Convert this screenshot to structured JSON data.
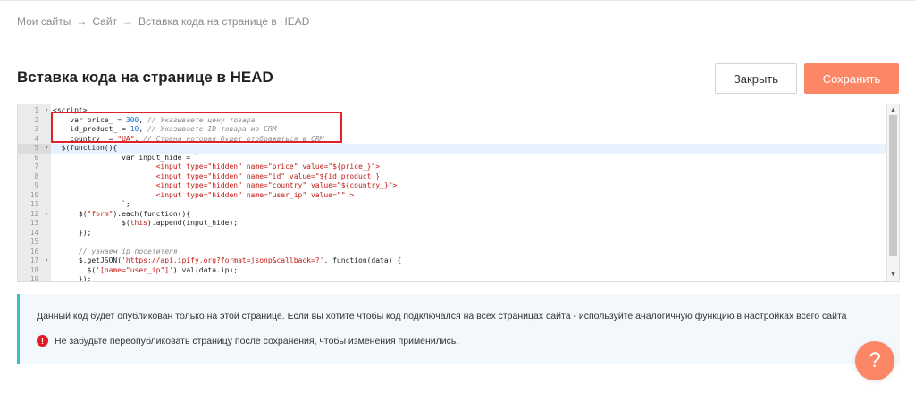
{
  "breadcrumb": {
    "items": [
      "Мои сайты",
      "Сайт",
      "Вставка кода на странице в HEAD"
    ],
    "separator": "→"
  },
  "header": {
    "title": "Вставка кода на странице в HEAD",
    "close_label": "Закрыть",
    "save_label": "Сохранить"
  },
  "editor": {
    "line_numbers": [
      "1",
      "2",
      "3",
      "4",
      "5",
      "6",
      "7",
      "8",
      "9",
      "10",
      "11",
      "12",
      "13",
      "14",
      "15",
      "16",
      "17",
      "18",
      "19"
    ],
    "fold_lines": [
      "1",
      "5",
      "12",
      "17"
    ],
    "active_line": "5",
    "lines": [
      [
        [
          "<script>",
          "plain"
        ]
      ],
      [
        [
          "    var price_ = ",
          "plain"
        ],
        [
          "300",
          "num"
        ],
        [
          ", ",
          "plain"
        ],
        [
          "// Указываете цену товара",
          "com"
        ]
      ],
      [
        [
          "    id_product_ = ",
          "plain"
        ],
        [
          "10",
          "num"
        ],
        [
          ", ",
          "plain"
        ],
        [
          "// Указываете ID товара из CRM",
          "com"
        ]
      ],
      [
        [
          "    country_ = ",
          "plain"
        ],
        [
          "\"UA\"",
          "str"
        ],
        [
          "; ",
          "plain"
        ],
        [
          "// Страна которая будет отображаться в CRM",
          "com"
        ]
      ],
      [
        [
          "  $(function(){",
          "plain"
        ]
      ],
      [
        [
          "                var input_hide = `",
          "plain"
        ]
      ],
      [
        [
          "                        ",
          "plain"
        ],
        [
          "<input type=\"hidden\" name=\"price\" value=\"${price_}\">",
          "tag"
        ]
      ],
      [
        [
          "                        ",
          "plain"
        ],
        [
          "<input type=\"hidden\" name=\"id\" value=\"${id_product_}",
          "tag"
        ]
      ],
      [
        [
          "                        ",
          "plain"
        ],
        [
          "<input type=\"hidden\" name=\"country\" value=\"${country_}\">",
          "tag"
        ]
      ],
      [
        [
          "                        ",
          "plain"
        ],
        [
          "<input type=\"hidden\" name=\"user_ip\" value=\"\" >",
          "tag"
        ]
      ],
      [
        [
          "                `;",
          "plain"
        ]
      ],
      [
        [
          "      $(",
          "plain"
        ],
        [
          "\"form\"",
          "str"
        ],
        [
          ").each(function(){",
          "plain"
        ]
      ],
      [
        [
          "                $(",
          "plain"
        ],
        [
          "this",
          "str"
        ],
        [
          ").append(input_hide);",
          "plain"
        ]
      ],
      [
        [
          "      });",
          "plain"
        ]
      ],
      [
        [
          "",
          "plain"
        ]
      ],
      [
        [
          "      ",
          "plain"
        ],
        [
          "// узнаем ip посетителя",
          "com"
        ]
      ],
      [
        [
          "      $.getJSON(",
          "plain"
        ],
        [
          "'https://api.ipify.org?format=jsonp&callback=?'",
          "str"
        ],
        [
          ", function(data) {",
          "plain"
        ]
      ],
      [
        [
          "        $(",
          "plain"
        ],
        [
          "'[name=\"user_ip\"]'",
          "str"
        ],
        [
          ").val(data.ip);",
          "plain"
        ]
      ],
      [
        [
          "      });",
          "plain"
        ]
      ]
    ]
  },
  "notice": {
    "info_text": "Данный код будет опубликован только на этой странице. Если вы хотите чтобы код подключался на всех страницах сайта - используйте аналогичную функцию в настройках всего сайта",
    "warning_icon": "!",
    "warning_text": "Не забудьте переопубликовать страницу после сохранения, чтобы изменения применились."
  },
  "help": {
    "label": "?"
  },
  "colors": {
    "accent": "#fb8767",
    "info_border": "#31c3c8",
    "warning": "#e01c24",
    "highlight_box": "#e0202a"
  },
  "icons": {
    "scroll_up": "scroll-up-arrow-icon",
    "scroll_down": "scroll-down-arrow-icon",
    "fold": "fold-arrow-icon",
    "help": "question-mark-icon"
  }
}
